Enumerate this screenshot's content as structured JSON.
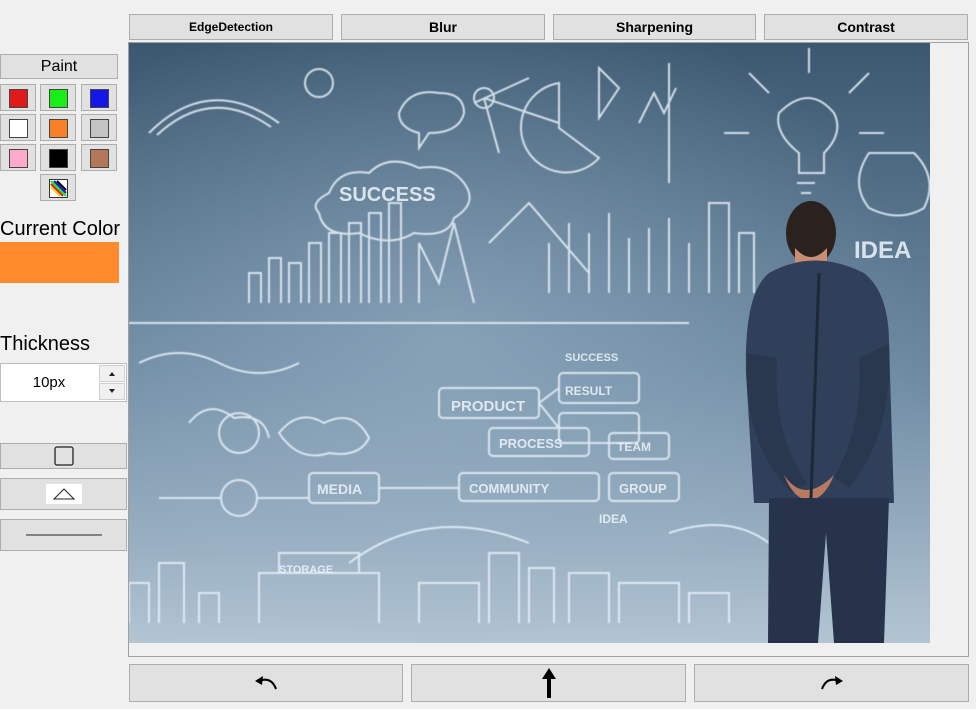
{
  "toolbar": {
    "edge_detection": "EdgeDetection",
    "blur": "Blur",
    "sharpening": "Sharpening",
    "contrast": "Contrast"
  },
  "palette": {
    "paint_label": "Paint",
    "colors": [
      "#e01a1a",
      "#1aee1a",
      "#1515e6",
      "#ffffff",
      "#f9802a",
      "#c3c3c3",
      "#ffaacc",
      "#000000",
      "#b5775a"
    ],
    "multicolor_icon": "multicolor-picker-icon"
  },
  "current_color": {
    "label": "Current Color",
    "value": "#ff8a2c"
  },
  "thickness": {
    "label": "Thickness",
    "value": "10px"
  },
  "shapes": {
    "rectangle_icon": "square-outline-icon",
    "triangle_icon": "triangle-outline-icon",
    "line_icon": "line-icon"
  },
  "canvas": {
    "image_words": [
      "SUCCESS",
      "PRODUCT",
      "RESULT",
      "SUCCESS",
      "PROCESS",
      "TEAM",
      "MEDIA",
      "COMMUNITY",
      "GROUP",
      "IDEA",
      "IDEA",
      "STORAGE"
    ]
  },
  "actions": {
    "undo_icon": "undo-arrow-icon",
    "upload_icon": "upload-arrow-icon",
    "redo_icon": "redo-arrow-icon"
  }
}
